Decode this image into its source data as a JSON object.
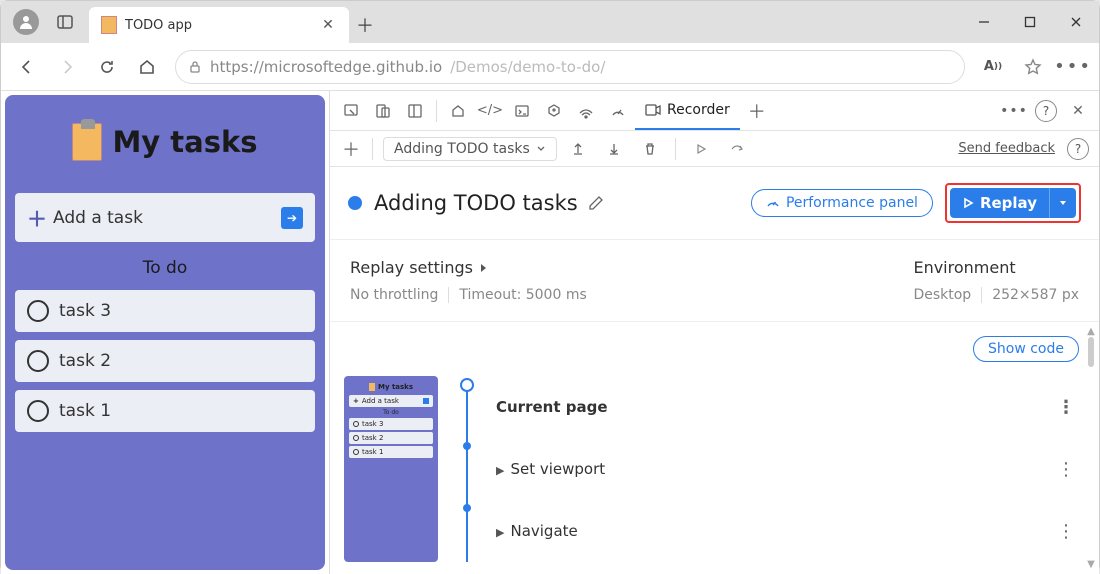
{
  "browser": {
    "tab_label": "TODO app",
    "url_secure": "https://microsoftedge.github.io",
    "url_path": "/Demos/demo-to-do/"
  },
  "app": {
    "title": "My tasks",
    "add_task_label": "Add a task",
    "section_label": "To do",
    "tasks": [
      "task 3",
      "task 2",
      "task 1"
    ]
  },
  "devtools": {
    "recorder_tab": "Recorder",
    "recording_name_short": "Adding TODO tasks",
    "send_feedback": "Send feedback",
    "title": "Adding TODO tasks",
    "perf_panel": "Performance panel",
    "replay": "Replay",
    "replay_settings_label": "Replay settings",
    "throttling": "No throttling",
    "timeout": "Timeout: 5000 ms",
    "env_label": "Environment",
    "env_device": "Desktop",
    "env_size": "252×587 px",
    "show_code": "Show code",
    "steps": {
      "current_page": "Current page",
      "set_viewport": "Set viewport",
      "navigate": "Navigate"
    },
    "thumb": {
      "title": "My tasks",
      "add": "Add a task",
      "section": "To do",
      "tasks": [
        "task 3",
        "task 2",
        "task 1"
      ]
    }
  }
}
